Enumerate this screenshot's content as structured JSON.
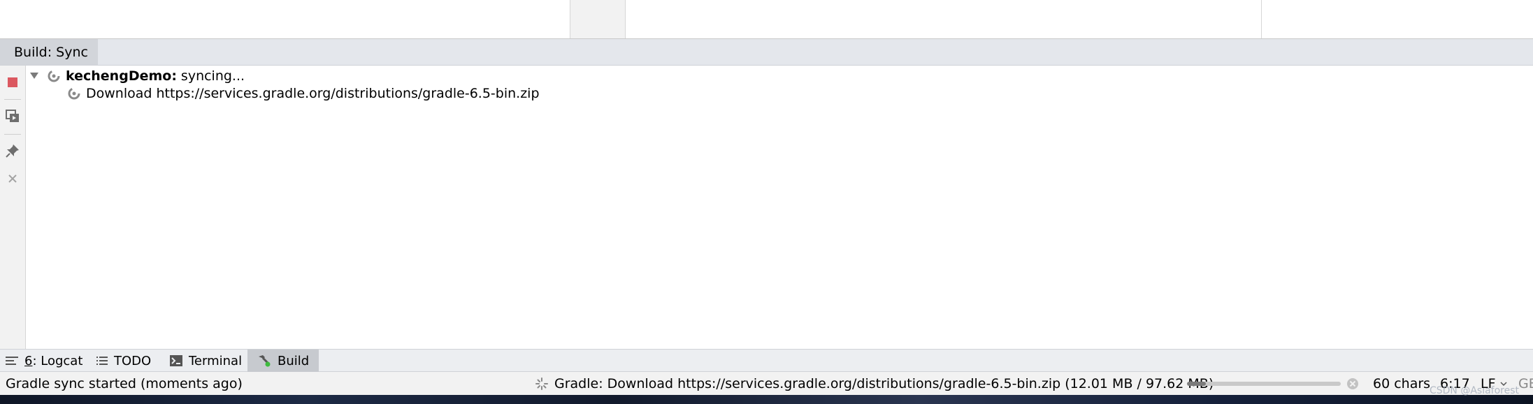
{
  "tool_window": {
    "tab_label": "Build: Sync"
  },
  "tree": {
    "root": {
      "name": "kechengDemo:",
      "status": "syncing..."
    },
    "child": {
      "label": "Download https://services.gradle.org/distributions/gradle-6.5-bin.zip"
    }
  },
  "toolbar_icons": [
    "stop-icon",
    "restore-layout-icon",
    "pin-icon",
    "close-icon"
  ],
  "bottom_tabs": [
    {
      "number": "6",
      "label": ": Logcat",
      "icon": "logcat-icon"
    },
    {
      "label": "TODO",
      "icon": "todo-list-icon"
    },
    {
      "label": "Terminal",
      "icon": "terminal-icon"
    },
    {
      "label": "Build",
      "icon": "hammer-icon",
      "active": true
    }
  ],
  "status_bar": {
    "message": "Gradle sync started (moments ago)",
    "progress_text": "Gradle: Download https://services.gradle.org/distributions/gradle-6.5-bin.zip  (12.01 MB / 97.62 MB)",
    "progress_fraction": 0.123,
    "chars": "60 chars",
    "position": "6:17",
    "line_separator": "LF",
    "encoding": "GB"
  },
  "watermark": "CSDN @Asiaforest",
  "colors": {
    "stop_red": "#d9534f",
    "active_tab": "#c7cacf",
    "header_bg": "#e4e7ec"
  }
}
